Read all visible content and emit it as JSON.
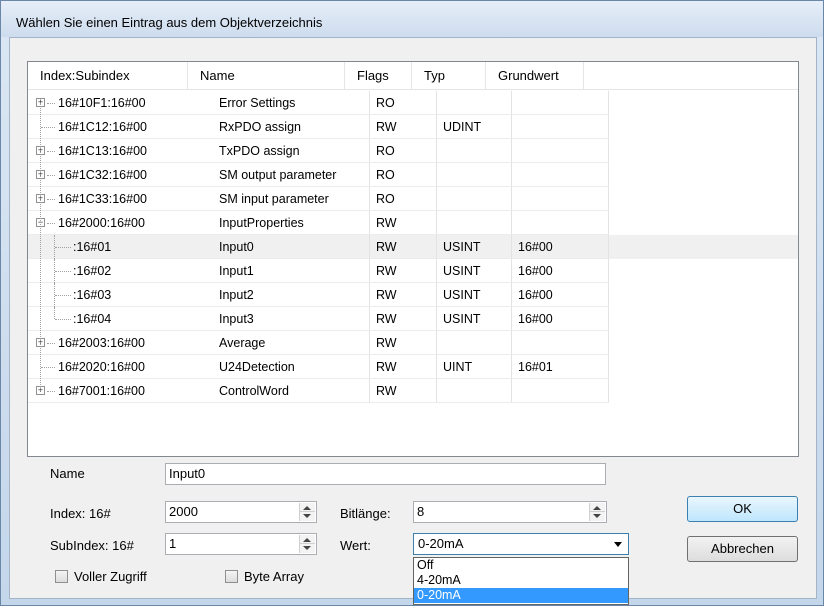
{
  "window": {
    "title": "Wählen Sie einen Eintrag aus dem Objektverzeichnis"
  },
  "columns": [
    "Index:Subindex",
    "Name",
    "Flags",
    "Typ",
    "Grundwert"
  ],
  "rows": [
    {
      "index": "16#10F1:16#00",
      "name": "Error Settings",
      "flags": "RO",
      "type": "",
      "default": "",
      "expander": "+"
    },
    {
      "index": "16#1C12:16#00",
      "name": "RxPDO assign",
      "flags": "RW",
      "type": "UDINT",
      "default": "",
      "expander": ""
    },
    {
      "index": "16#1C13:16#00",
      "name": "TxPDO assign",
      "flags": "RO",
      "type": "",
      "default": "",
      "expander": "+"
    },
    {
      "index": "16#1C32:16#00",
      "name": "SM output parameter",
      "flags": "RO",
      "type": "",
      "default": "",
      "expander": "+"
    },
    {
      "index": "16#1C33:16#00",
      "name": "SM input parameter",
      "flags": "RO",
      "type": "",
      "default": "",
      "expander": "+"
    },
    {
      "index": "16#2000:16#00",
      "name": "InputProperties",
      "flags": "RW",
      "type": "",
      "default": "",
      "expander": "−"
    },
    {
      "index": ":16#01",
      "name": "Input0",
      "flags": "RW",
      "type": "USINT",
      "default": "16#00",
      "expander": ""
    },
    {
      "index": ":16#02",
      "name": "Input1",
      "flags": "RW",
      "type": "USINT",
      "default": "16#00",
      "expander": ""
    },
    {
      "index": ":16#03",
      "name": "Input2",
      "flags": "RW",
      "type": "USINT",
      "default": "16#00",
      "expander": ""
    },
    {
      "index": ":16#04",
      "name": "Input3",
      "flags": "RW",
      "type": "USINT",
      "default": "16#00",
      "expander": ""
    },
    {
      "index": "16#2003:16#00",
      "name": "Average",
      "flags": "RW",
      "type": "",
      "default": "",
      "expander": "+"
    },
    {
      "index": "16#2020:16#00",
      "name": "U24Detection",
      "flags": "RW",
      "type": "UINT",
      "default": "16#01",
      "expander": ""
    },
    {
      "index": "16#7001:16#00",
      "name": "ControlWord",
      "flags": "RW",
      "type": "",
      "default": "",
      "expander": "+"
    }
  ],
  "selected_row": 6,
  "form": {
    "name_label": "Name",
    "name_value": "Input0",
    "index_label": "Index:  16#",
    "index_value": "2000",
    "subindex_label": "SubIndex:  16#",
    "subindex_value": "1",
    "bitlength_label": "Bitlänge:",
    "bitlength_value": "8",
    "value_label": "Wert:",
    "value_selected": "0-20mA",
    "value_options": [
      "Off",
      "4-20mA",
      "0-20mA"
    ],
    "full_access_label": "Voller Zugriff",
    "byte_array_label": "Byte Array"
  },
  "buttons": {
    "ok": "OK",
    "cancel": "Abbrechen"
  }
}
